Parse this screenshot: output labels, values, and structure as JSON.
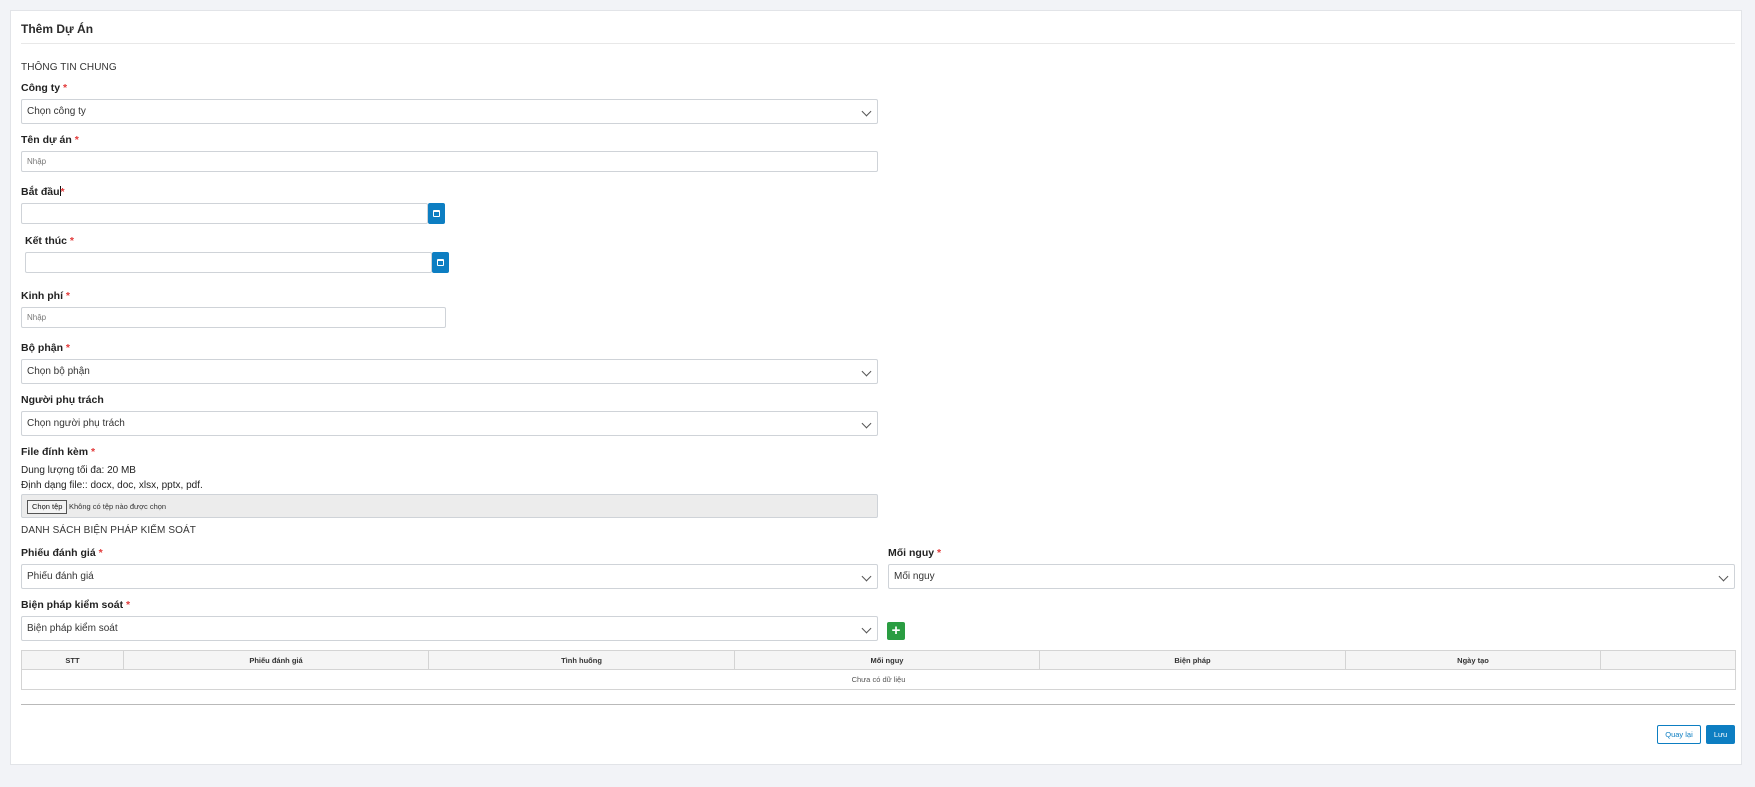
{
  "page": {
    "title": "Thêm Dự Án"
  },
  "general": {
    "section_title": "THÔNG TIN CHUNG",
    "required_mark": "*",
    "company": {
      "label": "Công ty",
      "value": "Chọn công ty"
    },
    "project_name": {
      "label": "Tên dự án",
      "placeholder": "Nhập"
    },
    "start": {
      "label": "Bắt đầu",
      "value": ""
    },
    "end": {
      "label": "Kết thúc",
      "value": ""
    },
    "budget": {
      "label": "Kinh phí",
      "placeholder": "Nhập"
    },
    "department": {
      "label": "Bộ phận",
      "value": "Chọn bộ phận"
    },
    "owner": {
      "label": "Người phụ trách",
      "value": "Chọn người phụ trách"
    },
    "attachment": {
      "label": "File đính kèm",
      "max_size": "Dung lượng tối đa: 20 MB",
      "formats": "Định dạng file:: docx, doc, xlsx, pptx, pdf.",
      "button": "Chọn tệp",
      "status": "Không có tệp nào được chọn"
    }
  },
  "controls": {
    "section_title": "DANH SÁCH BIỆN PHÁP KIỂM SOÁT",
    "assessment": {
      "label": "Phiếu đánh giá",
      "value": "Phiếu đánh giá"
    },
    "hazard": {
      "label": "Mối nguy",
      "value": "Mối nguy"
    },
    "measure": {
      "label": "Biện pháp kiểm soát",
      "value": "Biện pháp kiểm soát"
    },
    "add_icon": "plus-icon"
  },
  "table": {
    "columns": [
      "STT",
      "Phiếu đánh giá",
      "Tình huống",
      "Mối nguy",
      "Biện pháp",
      "Ngày tạo",
      ""
    ],
    "empty": "Chưa có dữ liệu"
  },
  "footer": {
    "back": "Quay lại",
    "save": "Lưu"
  },
  "colors": {
    "primary": "#0d7ec2",
    "success": "#2a9d42",
    "required": "#e23a3a"
  }
}
